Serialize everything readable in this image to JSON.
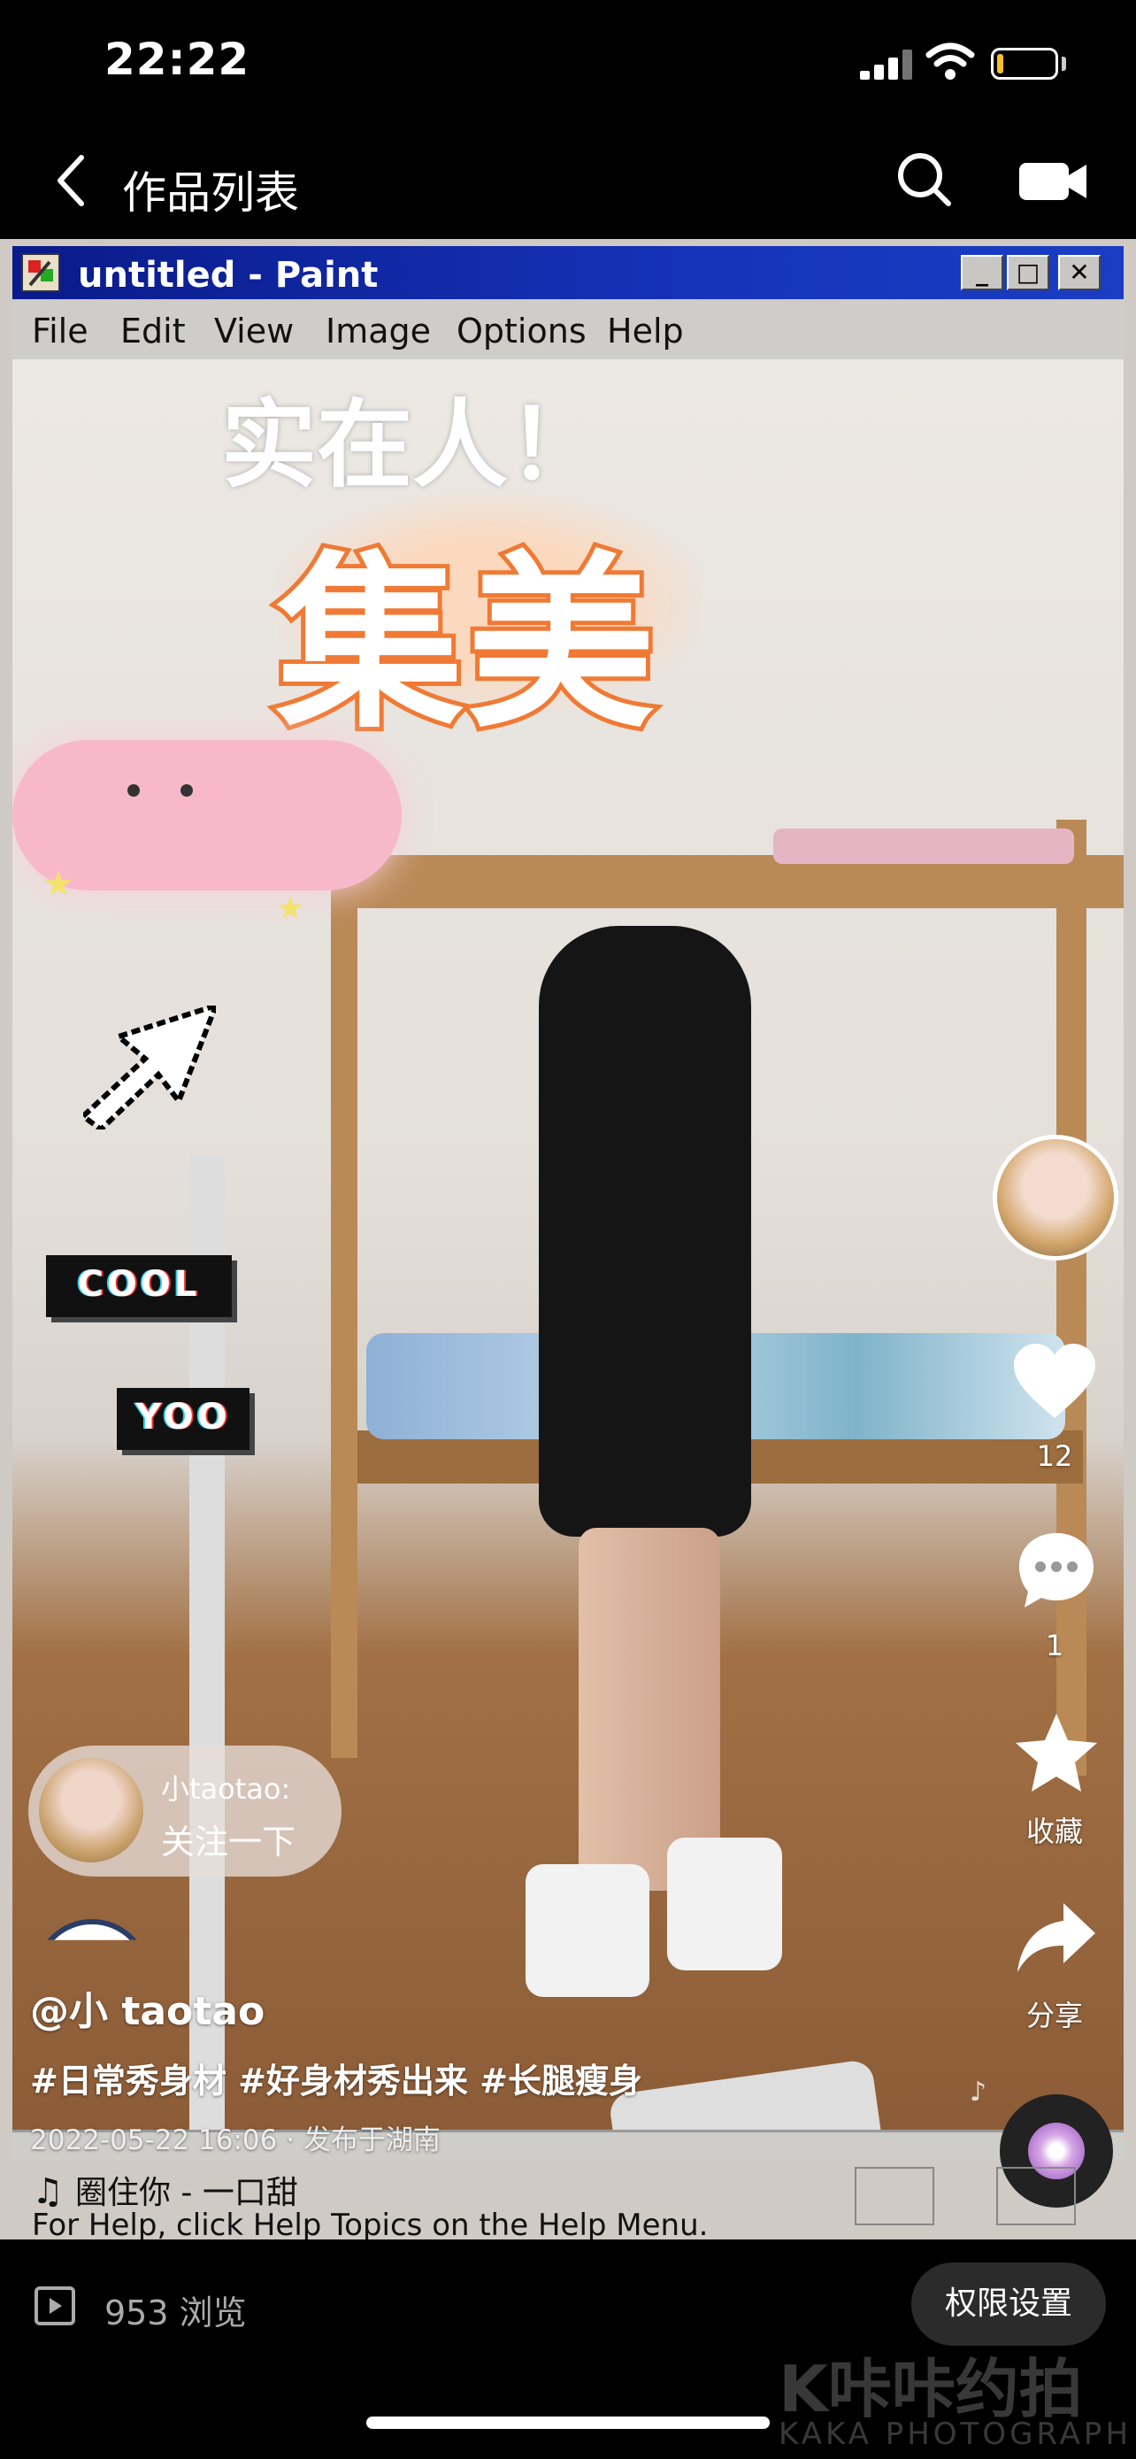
{
  "status_bar": {
    "time": "22:22",
    "battery_color": "#f6c02d"
  },
  "nav": {
    "title": "作品列表",
    "icons": [
      "back-chevron-icon",
      "search-icon",
      "camera-icon"
    ]
  },
  "paint_window": {
    "title": "untitled - Paint",
    "menu": [
      "File",
      "Edit",
      "View",
      "Image",
      "Options",
      "Help"
    ],
    "status_hint": "For Help, click Help Topics on the Help Menu."
  },
  "stickers": {
    "top_phrase": "实在人！",
    "headline": "集美",
    "cool": "COOL",
    "yoo": "YOO"
  },
  "comment_bubble": {
    "username": "小taotao:",
    "text": "关注一下"
  },
  "right_rail": {
    "like_count": "12",
    "comment_count": "1",
    "favorite_label": "收藏",
    "share_label": "分享"
  },
  "post": {
    "author": "@小 taotao",
    "hashtags": "#日常秀身材 #好身材秀出来 #长腿瘦身",
    "timestamp": "2022-05-22 16:06",
    "location": "发布于湖南",
    "music": "圈住你 - 一口甜"
  },
  "bottom_bar": {
    "views": "953 浏览",
    "permission_button": "权限设置"
  },
  "watermark": {
    "main": "K咔咔约拍",
    "sub": "KAKA PHOTOGRAPH"
  },
  "colors": {
    "accent_orange": "#f07a35",
    "paint_titlebar": "#1533b8"
  }
}
